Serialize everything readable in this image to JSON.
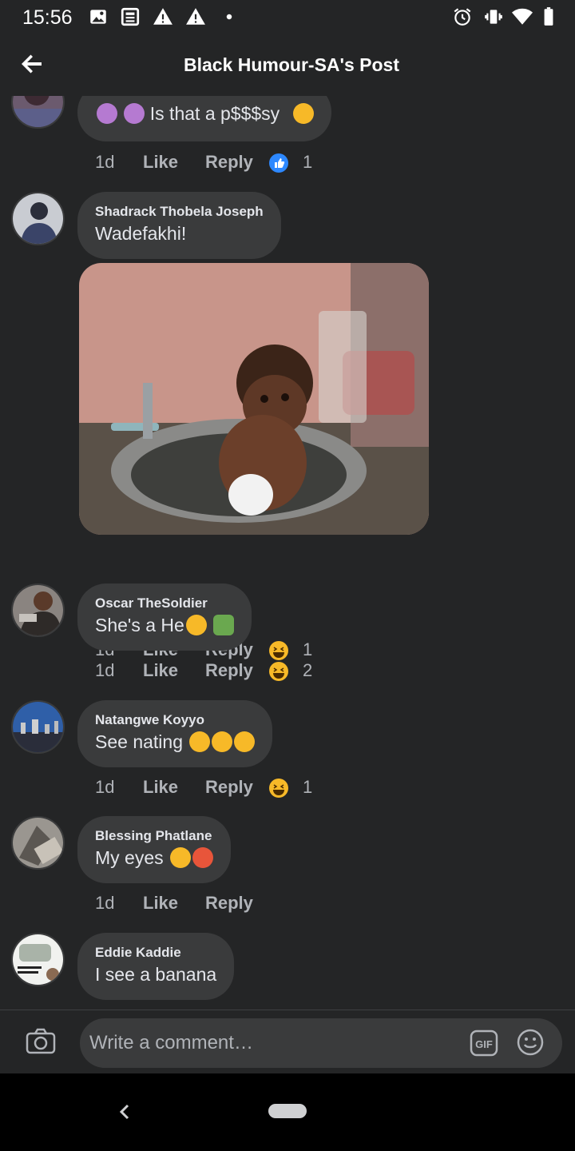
{
  "status_bar": {
    "time": "15:56",
    "left_icons": [
      "image-icon",
      "news-icon",
      "warning-icon",
      "warning-icon",
      "dot-icon"
    ],
    "right_icons": [
      "alarm-icon",
      "vibrate-icon",
      "wifi-icon",
      "battery-icon"
    ]
  },
  "header": {
    "title": "Black Humour-SA's Post",
    "back_icon": "arrow-left-icon"
  },
  "actions_labels": {
    "like": "Like",
    "reply": "Reply"
  },
  "comments": [
    {
      "author": "",
      "text": "Is that a p$$$sy",
      "time": "1d",
      "reaction": "like",
      "reaction_count": "1"
    },
    {
      "author": "Shadrack Thobela Joseph",
      "text": "Wadefakhi!",
      "time": "1d",
      "reaction": "haha",
      "reaction_count": "1",
      "has_photo": true
    },
    {
      "author": "Oscar TheSoldier",
      "text": "She's a He",
      "time": "1d",
      "reaction": "haha",
      "reaction_count": "2"
    },
    {
      "author": "Natangwe Koyyo",
      "text": "See nating",
      "time": "1d",
      "reaction": "haha",
      "reaction_count": "1"
    },
    {
      "author": "Blessing Phatlane",
      "text": "My eyes",
      "time": "1d",
      "reaction": null,
      "reaction_count": ""
    },
    {
      "author": "Eddie Kaddie",
      "text": "I see a banana",
      "time": "",
      "reaction": null,
      "reaction_count": ""
    }
  ],
  "composer": {
    "placeholder": "Write a comment…",
    "camera_icon": "camera-icon",
    "gif_icon": "gif-icon",
    "emoji_icon": "smiley-icon"
  },
  "nav_bar": {
    "back_icon": "nav-back-icon",
    "home_icon": "home-pill-icon"
  },
  "colors": {
    "background": "#242526",
    "bubble": "#3a3b3c",
    "text": "#e4e6eb",
    "muted": "#b0b3b8",
    "like_blue": "#2d88ff",
    "haha_yellow": "#f7b928"
  }
}
